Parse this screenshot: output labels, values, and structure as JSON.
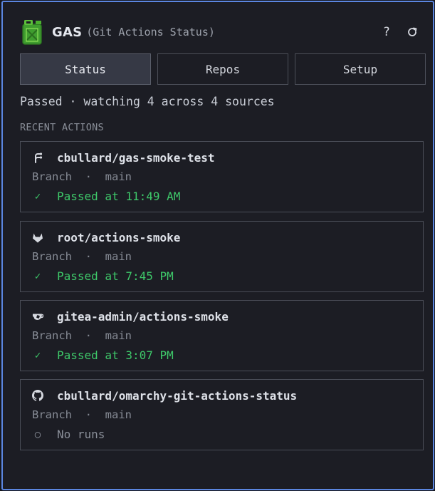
{
  "app": {
    "name": "GAS",
    "subtitle": "(Git Actions Status)",
    "help_label": "?",
    "logo_icon": "fuel-can-icon",
    "accent_color": "#5b86e0"
  },
  "tabs": [
    {
      "label": "Status",
      "active": true
    },
    {
      "label": "Repos",
      "active": false
    },
    {
      "label": "Setup",
      "active": false
    }
  ],
  "summary": "Passed · watching 4 across 4 sources",
  "section_label": "RECENT ACTIONS",
  "actions": [
    {
      "repo": "cbullard/gas-smoke-test",
      "icon": "forgejo-icon",
      "branch_line": "Branch  ·  main",
      "status_mark": "✓",
      "status_text": "Passed at 11:49 AM",
      "status": "passed"
    },
    {
      "repo": "root/actions-smoke",
      "icon": "gitlab-icon",
      "branch_line": "Branch  ·  main",
      "status_mark": "✓",
      "status_text": "Passed at 7:45 PM",
      "status": "passed"
    },
    {
      "repo": "gitea-admin/actions-smoke",
      "icon": "gitea-icon",
      "branch_line": "Branch  ·  main",
      "status_mark": "✓",
      "status_text": "Passed at 3:07 PM",
      "status": "passed"
    },
    {
      "repo": "cbullard/omarchy-git-actions-status",
      "icon": "github-icon",
      "branch_line": "Branch  ·  main",
      "status_mark": "○",
      "status_text": "No runs",
      "status": "none"
    }
  ],
  "colors": {
    "passed": "#3ec96a",
    "muted": "#8a8f99"
  }
}
